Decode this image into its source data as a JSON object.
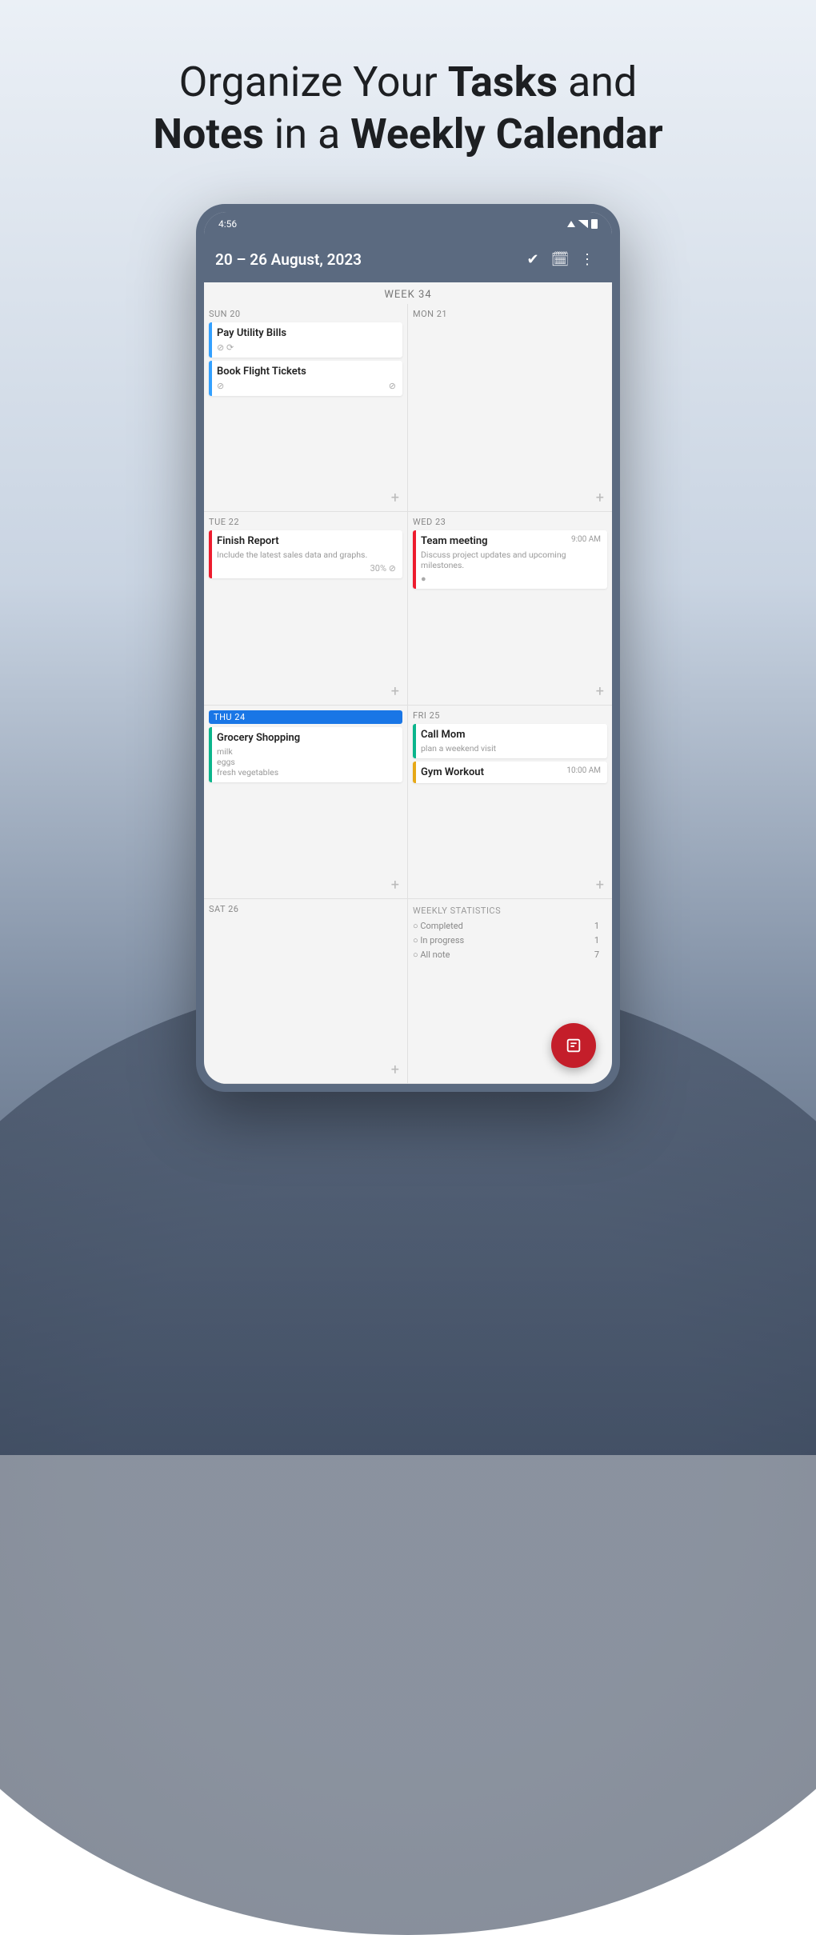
{
  "promo": {
    "line1_a": "Organize Your ",
    "line1_b": "Tasks",
    "line1_c": " and",
    "line2_a": "Notes",
    "line2_b": " in a ",
    "line2_c": "Weekly Calendar"
  },
  "status": {
    "time": "4:56"
  },
  "appbar": {
    "title": "20 – 26 August, 2023"
  },
  "week_label": "WEEK 34",
  "days": [
    {
      "hdr": "SUN 20",
      "today": false,
      "tasks": [
        {
          "title": "Pay Utility Bills",
          "desc": "",
          "color": "#33a0ff",
          "meta_left": "⊘ ⟳",
          "meta_right": ""
        },
        {
          "title": "Book Flight Tickets",
          "desc": "",
          "color": "#33a0ff",
          "meta_left": "⊘",
          "meta_right": "⊘"
        }
      ]
    },
    {
      "hdr": "MON 21",
      "today": false,
      "tasks": []
    },
    {
      "hdr": "TUE 22",
      "today": false,
      "tasks": [
        {
          "title": "Finish Report",
          "desc": "Include the latest sales data and graphs.",
          "color": "#ed1c2e",
          "meta_left": "",
          "meta_right": "30% ⊘"
        }
      ]
    },
    {
      "hdr": "WED 23",
      "today": false,
      "tasks": [
        {
          "title": "Team meeting",
          "desc": "Discuss project updates and upcoming milestones.",
          "color": "#ed1c2e",
          "time": "9:00 AM",
          "meta_left": "●",
          "meta_right": ""
        }
      ]
    },
    {
      "hdr": "THU 24",
      "today": true,
      "tasks": [
        {
          "title": "Grocery Shopping",
          "desc": "milk\neggs\nfresh vegetables",
          "color": "#0bb58c"
        }
      ]
    },
    {
      "hdr": "FRI 25",
      "today": false,
      "tasks": [
        {
          "title": "Call Mom",
          "desc": "plan a weekend visit",
          "color": "#0bb58c"
        },
        {
          "title": "Gym Workout",
          "desc": "",
          "color": "#e6a817",
          "time": "10:00 AM"
        }
      ]
    },
    {
      "hdr": "SAT 26",
      "today": false,
      "tasks": []
    }
  ],
  "stats": {
    "header": "WEEKLY STATISTICS",
    "rows": [
      {
        "label": "Completed",
        "val": "1"
      },
      {
        "label": "In progress",
        "val": "1"
      },
      {
        "label": "All note",
        "val": "7"
      }
    ]
  },
  "plus": "+"
}
